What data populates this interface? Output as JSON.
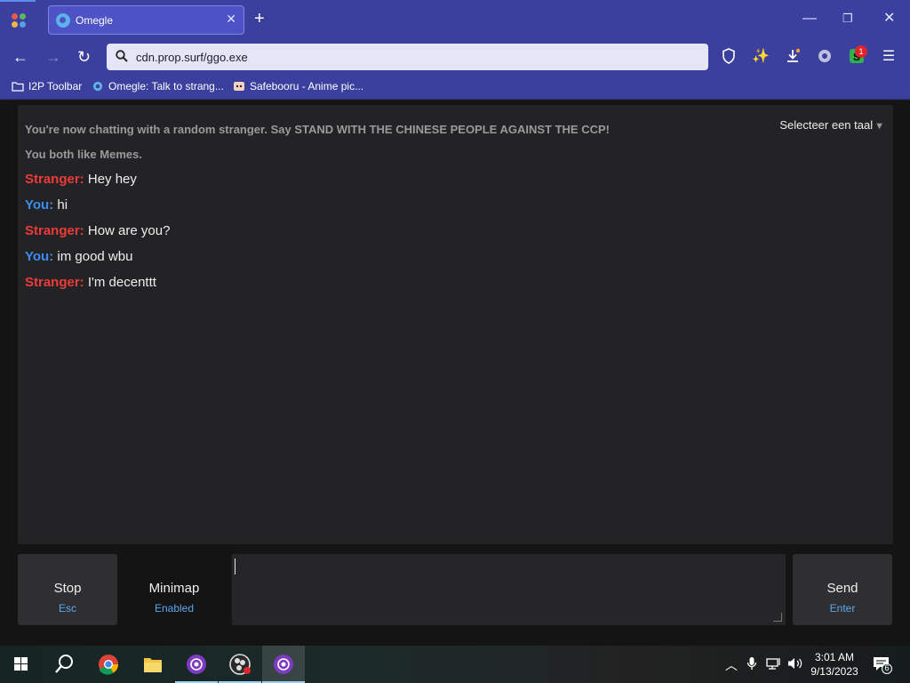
{
  "browser": {
    "tab": {
      "title": "Omegle"
    },
    "address": {
      "url": "cdn.prop.surf/ggo.exe"
    },
    "extension_badge_count": "1",
    "bookmarks": [
      {
        "label": "I2P Toolbar"
      },
      {
        "label": "Omegle: Talk to strang..."
      },
      {
        "label": "Safebooru - Anime pic..."
      }
    ]
  },
  "chat": {
    "system_messages": [
      "You're now chatting with a random stranger. Say STAND WITH THE CHINESE PEOPLE AGAINST THE CCP!",
      "You both like Memes."
    ],
    "language_selector": "Selecteer een taal",
    "messages": [
      {
        "sender": "Stranger:",
        "text": "Hey hey"
      },
      {
        "sender": "You:",
        "text": "hi"
      },
      {
        "sender": "Stranger:",
        "text": "How are you?"
      },
      {
        "sender": "You:",
        "text": "im good wbu"
      },
      {
        "sender": "Stranger:",
        "text": "I'm decenttt"
      }
    ],
    "controls": {
      "stop": {
        "label": "Stop",
        "hint": "Esc"
      },
      "minimap": {
        "label": "Minimap",
        "status": "Enabled"
      },
      "send": {
        "label": "Send",
        "hint": "Enter"
      }
    }
  },
  "taskbar": {
    "time": "3:01 AM",
    "date": "9/13/2023",
    "notification_count": "6"
  },
  "colors": {
    "browser_chrome": "#3b3f9e",
    "stranger": "#ef3a3a",
    "you": "#3a8ef0",
    "hint": "#5ea6ee"
  }
}
